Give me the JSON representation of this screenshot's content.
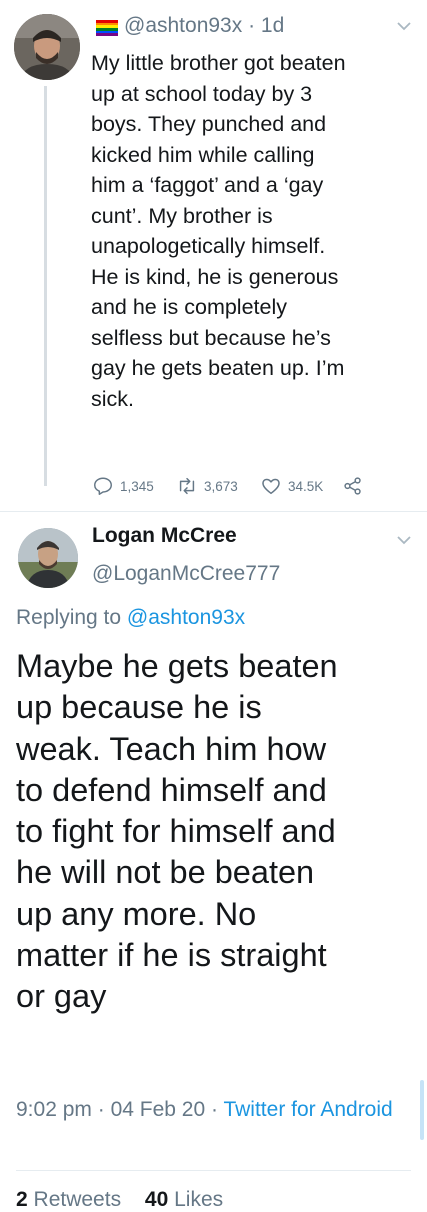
{
  "parent_tweet": {
    "handle": "@ashton93x",
    "separator": "·",
    "time": "1d",
    "text": "My little brother got beaten\nup at school today by 3\nboys. They punched and\nkicked him while calling\nhim a ‘faggot’ and a ‘gay\ncunt’. My brother is\nunapologetically himself.\nHe is kind, he is generous\nand he is completely\nselfless but because he’s\ngay he gets beaten up. I’m\nsick.",
    "actions": {
      "replies": "1,345",
      "retweets": "3,673",
      "likes": "34.5K"
    },
    "flag_icon": "rainbow-flag-emoji",
    "flag_colors": [
      "#e40303",
      "#ff8c00",
      "#ffed00",
      "#008026",
      "#004dff",
      "#750787"
    ]
  },
  "reply_tweet": {
    "name": "Logan McCree",
    "handle": "@LoganMcCree777",
    "replying_label": "Replying to",
    "replying_to": "@ashton93x",
    "text": "Maybe he gets beaten\nup because he is\nweak. Teach him how\nto defend himself and\nto fight for himself and\nhe will not be beaten\nup any more. No\nmatter if he is straight\nor gay",
    "time": "9:02 pm",
    "date": "04 Feb 20",
    "dot": "·",
    "source": "Twitter for Android",
    "stats": {
      "retweets_count": "2",
      "retweets_label": "Retweets",
      "likes_count": "40",
      "likes_label": "Likes"
    }
  },
  "colors": {
    "text": "#14171a",
    "secondary": "#657786",
    "link": "#1b95e0",
    "divider": "#e6ecf0"
  }
}
